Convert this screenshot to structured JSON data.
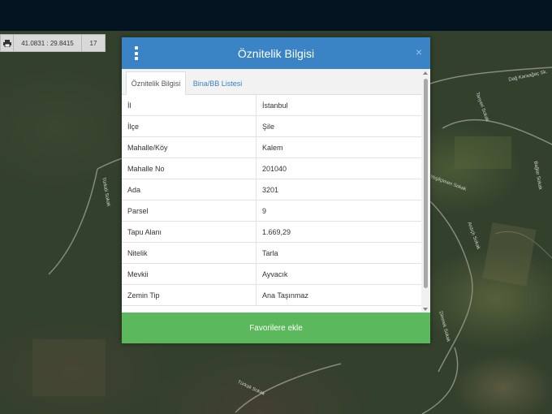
{
  "coord_bar": {
    "printer_icon": "printer-icon",
    "coordinates": "41.0831 : 29.8415",
    "zoom": "17"
  },
  "dialog": {
    "title": "Öznitelik Bilgisi",
    "menu_icon": "kebab-menu-icon",
    "close_label": "×",
    "tabs": [
      {
        "label": "Öznitelik Bilgisi",
        "active": true
      },
      {
        "label": "Bina/BB Listesi",
        "active": false
      }
    ],
    "rows": [
      {
        "key": "İl",
        "value": "İstanbul"
      },
      {
        "key": "İlçe",
        "value": "Şile"
      },
      {
        "key": "Mahalle/Köy",
        "value": "Kalem"
      },
      {
        "key": "Mahalle No",
        "value": "201040"
      },
      {
        "key": "Ada",
        "value": "3201"
      },
      {
        "key": "Parsel",
        "value": "9"
      },
      {
        "key": "Tapu Alanı",
        "value": "1.669,29"
      },
      {
        "key": "Nitelik",
        "value": "Tarla"
      },
      {
        "key": "Mevkii",
        "value": "Ayvacık"
      },
      {
        "key": "Zemin Tip",
        "value": "Ana Taşınmaz"
      }
    ],
    "favorite_button": "Favorilere ekle"
  },
  "map_labels": {
    "road1": "Dağ Karaağaç Sk.",
    "road2": "Yeşilçimen Sokak",
    "road3": "Bağlar Sokak",
    "road4": "Türkali Sokak",
    "road5": "Ardıçlı Sokak",
    "road6": "Tanyeri Sokak",
    "road7": "Türkali Sokak",
    "road8": "Dinmek Sokak"
  },
  "colors": {
    "header": "#3a84c6",
    "button": "#5cb85c",
    "topbar": "#041421"
  }
}
